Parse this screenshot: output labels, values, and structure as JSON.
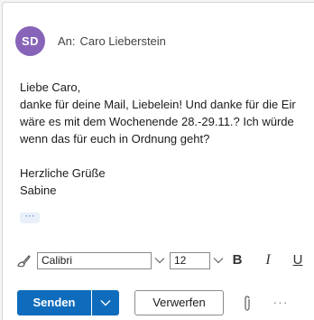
{
  "header": {
    "avatar_initials": "SD",
    "avatar_color": "#8764b8",
    "to_prefix": "An:",
    "recipient": "Caro Lieberstein"
  },
  "body": {
    "lines": [
      "Liebe Caro,",
      "danke für deine Mail, Liebelein! Und danke für die Eir",
      "wäre es mit dem Wochenende 28.-29.11.? Ich würde",
      "wenn das für euch in Ordnung geht?",
      "",
      "Herzliche Grüße",
      "Sabine"
    ],
    "expand_label": "···"
  },
  "format_bar": {
    "format_painter_icon": "brush-icon",
    "font_name": "Calibri",
    "font_size": "12",
    "bold_label": "B",
    "italic_label": "I",
    "underline_label": "U"
  },
  "actions": {
    "send_label": "Senden",
    "discard_label": "Verwerfen",
    "more_label": "···",
    "accent_color": "#0f6cbd"
  }
}
